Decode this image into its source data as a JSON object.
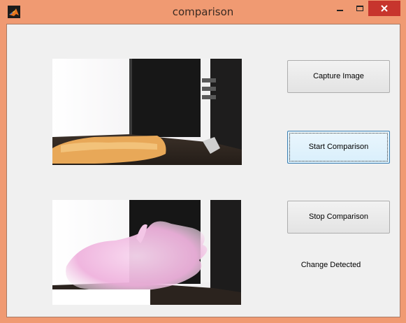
{
  "window": {
    "title": "comparison",
    "controls": [
      "minimize-icon",
      "maximize-icon",
      "close-icon"
    ]
  },
  "images": {
    "captured": "captured webcam frame",
    "live": "live webcam frame"
  },
  "buttons": {
    "capture": "Capture Image",
    "start": "Start Comparison",
    "stop": "Stop Comparison"
  },
  "status": {
    "text": "Change Detected"
  },
  "colors": {
    "frame": "#f09a72",
    "close": "#c7352d",
    "client": "#f0f0f0"
  }
}
